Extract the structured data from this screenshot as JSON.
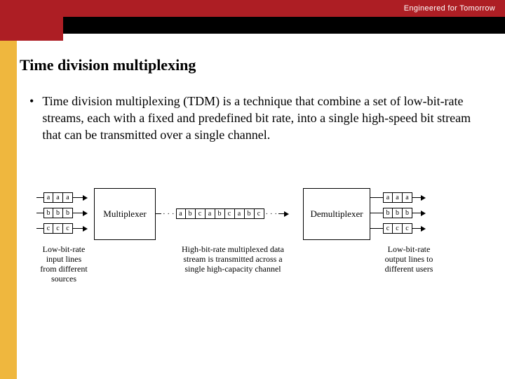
{
  "brand": "Engineered for Tomorrow",
  "title": "Time division multiplexing",
  "bullet": "Time division multiplexing (TDM) is a technique that combine a set of low-bit-rate streams, each with a fixed and predefined bit rate, into a single high-speed bit stream that can be transmitted over a single channel.",
  "diagram": {
    "streams": {
      "a": "a",
      "b": "b",
      "c": "c"
    },
    "multiplexer": "Multiplexer",
    "demultiplexer": "Demultiplexer",
    "dots": "· · ·",
    "caption_left": "Low-bit-rate\ninput lines\nfrom different\nsources",
    "caption_mid": "High-bit-rate multiplexed data\nstream is transmitted across a\nsingle high-capacity channel",
    "caption_right": "Low-bit-rate\noutput lines to\ndifferent users"
  }
}
